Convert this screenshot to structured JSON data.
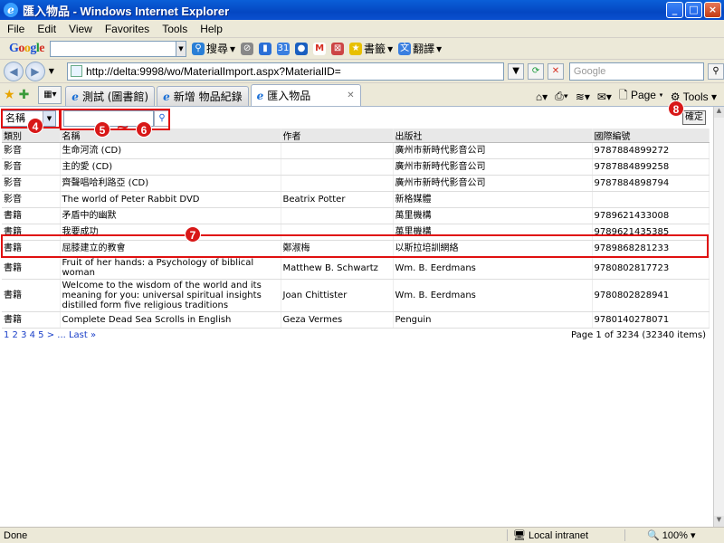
{
  "window": {
    "title": "匯入物品 - Windows Internet Explorer",
    "min": "_",
    "max": "□",
    "close": "×"
  },
  "menu": [
    "File",
    "Edit",
    "View",
    "Favorites",
    "Tools",
    "Help"
  ],
  "google_toolbar": {
    "logo": "Google",
    "search_label": "搜尋",
    "bookmarks_label": "書籤",
    "translate_label": "翻譯"
  },
  "address": {
    "url": "http://delta:9998/wo/MaterialImport.aspx?MaterialID=",
    "search_placeholder": "Google"
  },
  "tabs": [
    {
      "label": "測試 (圖書館)"
    },
    {
      "label": "新增 物品紀錄"
    },
    {
      "label": "匯入物品",
      "active": true
    }
  ],
  "commands": {
    "page": "Page",
    "tools": "Tools"
  },
  "filter": {
    "field_selected": "名稱",
    "search_value": "",
    "confirm_label": "確定"
  },
  "table": {
    "headers": [
      "類別",
      "名稱",
      "作者",
      "出版社",
      "國際編號"
    ],
    "rows": [
      [
        "影音",
        "生命河流 (CD)",
        "",
        "廣州市新時代影音公司",
        "9787884899272"
      ],
      [
        "影音",
        "主的愛 (CD)",
        "",
        "廣州市新時代影音公司",
        "9787884899258"
      ],
      [
        "影音",
        "齊聲唱哈利路亞 (CD)",
        "",
        "廣州市新時代影音公司",
        "9787884898794"
      ],
      [
        "影音",
        "The world of Peter Rabbit DVD",
        "Beatrix Potter",
        "新格媒體",
        ""
      ],
      [
        "書籍",
        "矛盾中的幽默",
        "",
        "萬里機構",
        "9789621433008"
      ],
      [
        "書籍",
        "我要成功",
        "",
        "萬里機構",
        "9789621435385"
      ],
      [
        "書籍",
        "屈膝建立的教會",
        "鄭淑梅",
        "以斯拉培訓網絡",
        "9789868281233"
      ],
      [
        "書籍",
        "Fruit of her hands: a Psychology of biblical woman",
        "Matthew B. Schwartz",
        "Wm. B. Eerdmans",
        "9780802817723"
      ],
      [
        "書籍",
        "Welcome to the wisdom of the world and its meaning for you: universal spiritual insights distilled form five religious traditions",
        "Joan Chittister",
        "Wm. B. Eerdmans",
        "9780802828941"
      ],
      [
        "書籍",
        "Complete Dead Sea Scrolls in English",
        "Geza Vermes",
        "Penguin",
        "9780140278071"
      ]
    ]
  },
  "pager": {
    "links": "1 2 3 4 5 > ... Last »",
    "info": "Page 1 of 3234 (32340 items)"
  },
  "annotations": [
    "4",
    "5",
    "6",
    "7",
    "8"
  ],
  "status": {
    "left": "Done",
    "zone": "Local intranet",
    "zoom": "100%"
  }
}
